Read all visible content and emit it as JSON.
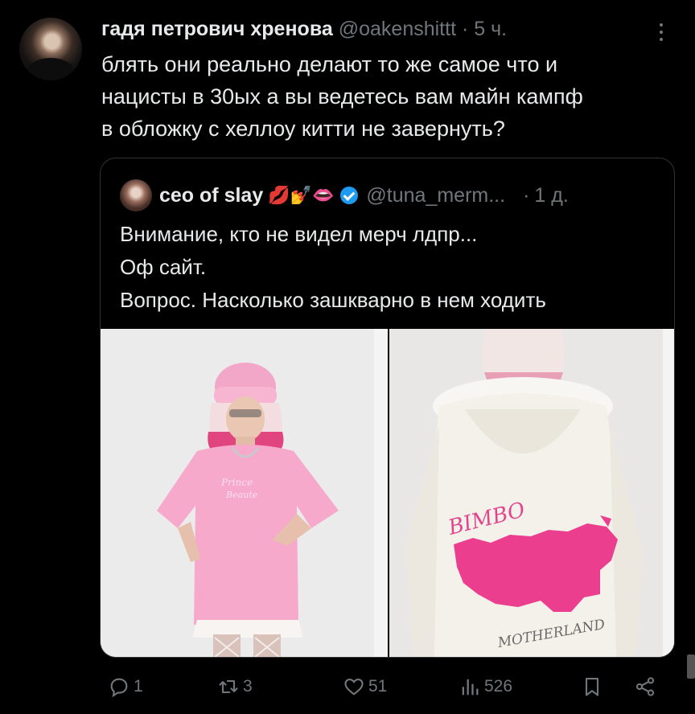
{
  "tweet": {
    "author_name": "гадя петрович хренова",
    "handle": "@oakenshittt",
    "separator": "·",
    "time": "5 ч.",
    "text_lines": [
      "блять они реально делают то же самое что и",
      "нацисты в 30ых а вы ведетесь вам майн кампф",
      "в обложку с хеллоу китти не завернуть?"
    ]
  },
  "quote": {
    "author_name": "ceo of slay",
    "emojis": "💋💅👄",
    "handle": "@tuna_merm...",
    "separator": "·",
    "time": "1 д.",
    "text_lines": [
      "Внимание, кто не видел мерч лдпр...",
      "Оф сайт.",
      "Вопрос. Насколько зашкварно в нем ходить"
    ],
    "photo_right_texts": {
      "bimbo": "BIMBO",
      "motherland": "MOTHERLAND"
    }
  },
  "actions": {
    "replies": "1",
    "reposts": "3",
    "likes": "51",
    "views": "526"
  }
}
